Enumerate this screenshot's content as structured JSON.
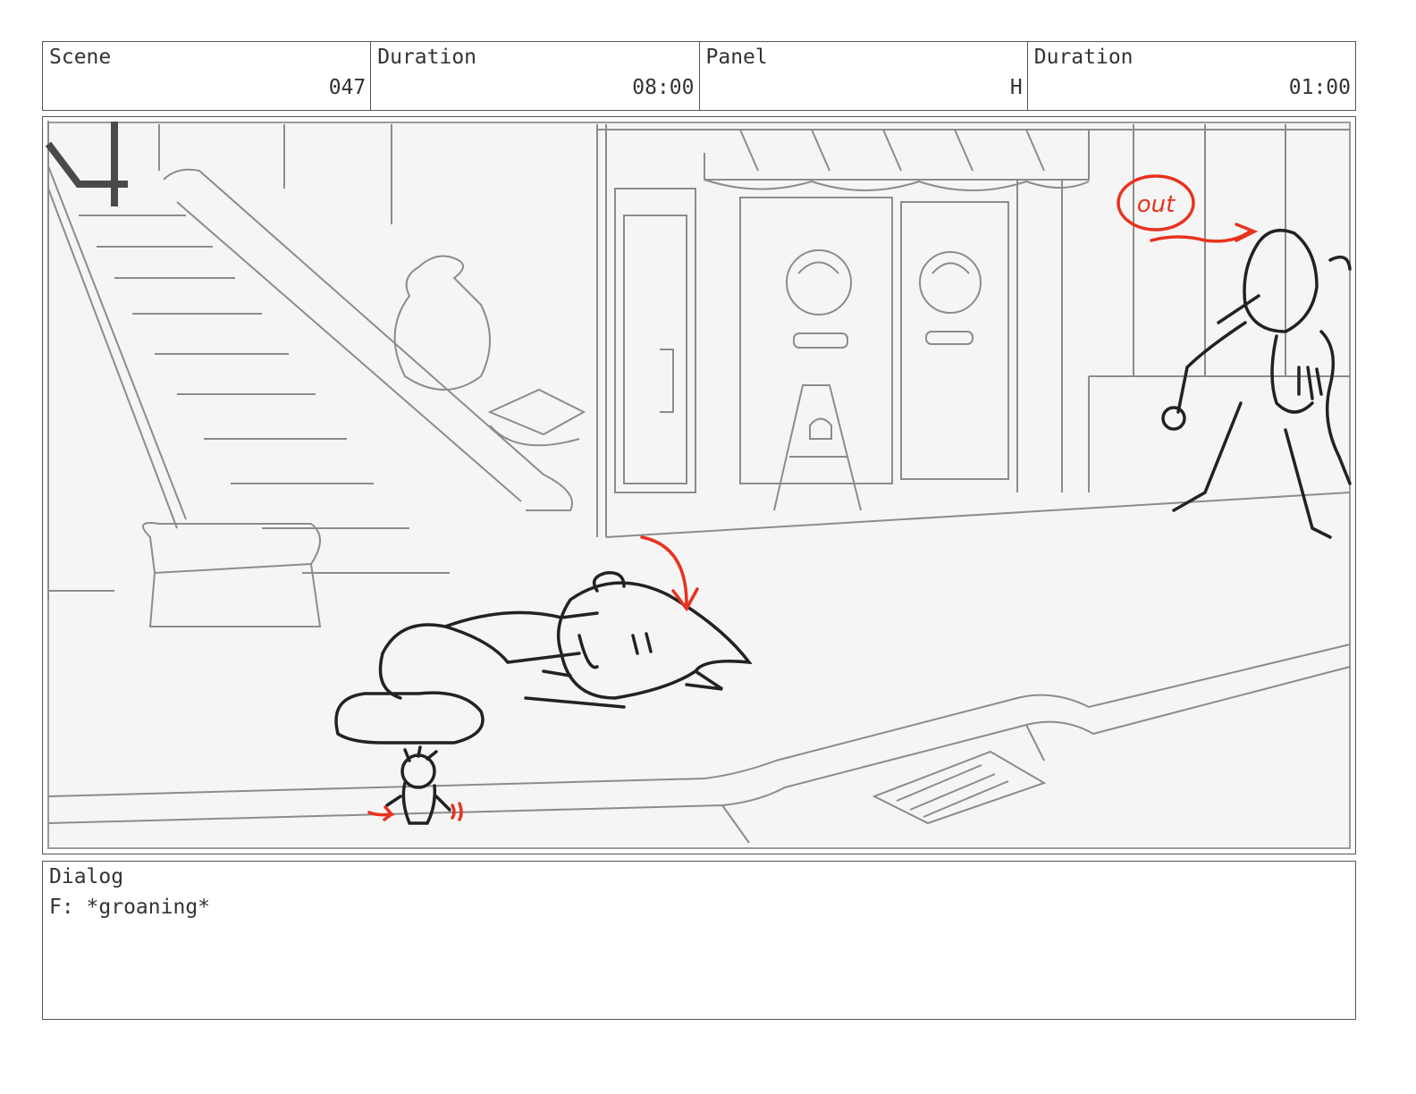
{
  "header": {
    "scene": {
      "label": "Scene",
      "value": "047"
    },
    "scene_duration": {
      "label": "Duration",
      "value": "08:00"
    },
    "panel": {
      "label": "Panel",
      "value": "H"
    },
    "panel_duration": {
      "label": "Duration",
      "value": "01:00"
    }
  },
  "artwork": {
    "annotation_text": "out",
    "line_color": "#222222",
    "background_line_color": "#8c8c8c",
    "markup_color": "#e8321e"
  },
  "dialog": {
    "label": "Dialog",
    "text": "F: *groaning*"
  }
}
